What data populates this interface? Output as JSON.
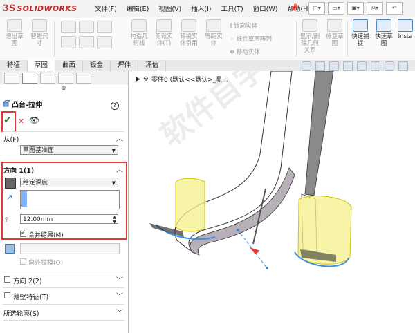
{
  "app": {
    "logo_prefix": "3S",
    "logo_name": "SOLIDWORKS"
  },
  "menu": [
    "文件(F)",
    "编辑(E)",
    "视图(V)",
    "插入(I)",
    "工具(T)",
    "窗口(W)",
    "帮助(H)"
  ],
  "ribbon": {
    "buttons": [
      {
        "label": "退出草\n图"
      },
      {
        "label": "智能尺\n寸"
      },
      {
        "label": "构造几\n何线"
      },
      {
        "label": "剪裁实\n体(T)"
      },
      {
        "label": "转换实\n体引用"
      },
      {
        "label": "等距实\n体"
      },
      {
        "label": "显示/删\n除几何\n关系"
      },
      {
        "label": "修复草\n图"
      },
      {
        "label": "快速捕\n捉"
      },
      {
        "label": "快速草\n图"
      },
      {
        "label": "Insta"
      }
    ],
    "small": [
      "镜向实体",
      "线性草图阵列",
      "移动实体"
    ]
  },
  "tabs": [
    "特征",
    "草图",
    "曲面",
    "钣金",
    "焊件",
    "评估"
  ],
  "active_tab": "草图",
  "panel": {
    "feature_title": "凸台-拉伸",
    "help": "?",
    "from_header": "从(F)",
    "from_value": "草图基准面",
    "direction1_header": "方向 1(1)",
    "end_condition": "给定深度",
    "depth_value": "12.00mm",
    "merge_label": "合并结果(M)",
    "draft_label": "向外拔模(O)",
    "direction2_header": "方向 2(2)",
    "thin_header": "薄壁特征(T)",
    "contours_header": "所选轮廓(S)"
  },
  "viewport": {
    "tree_label": "零件8 (默认<<默认>_显...",
    "watermark": "软件自学网"
  },
  "colors": {
    "highlight": "#e53935",
    "ok": "#2e7d32",
    "preview": "#f4f08a",
    "selection": "#3a8ee6"
  }
}
